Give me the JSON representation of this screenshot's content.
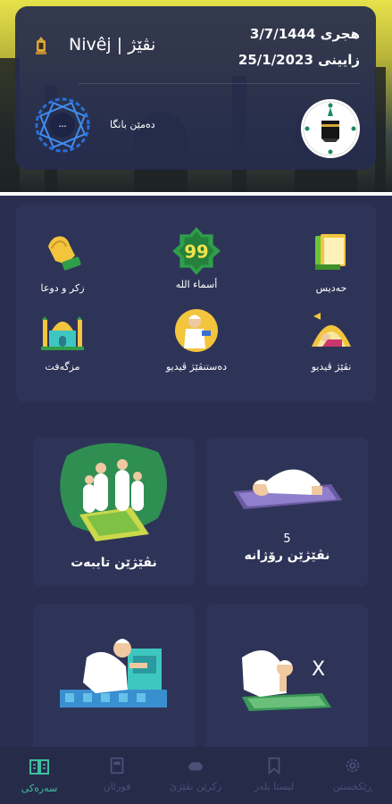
{
  "header": {
    "app_name": "Nivêj | نڤێژ",
    "hijri_date": "هجری 3/7/1444",
    "gregorian_date": "زایینی 25/1/2023",
    "adhan_label": "دەمێن بانگا"
  },
  "categories": [
    {
      "label": "حەدیس",
      "icon": "book-icon"
    },
    {
      "label": "أسماء الله",
      "icon": "99-names-icon",
      "badge": "99"
    },
    {
      "label": "زکر و دوعا",
      "icon": "praying-hands-icon"
    },
    {
      "label": "نڤێژ ڤیدیو",
      "icon": "prayer-video-icon"
    },
    {
      "label": "دەستنڤێژ ڤیدیو",
      "icon": "ablution-video-icon"
    },
    {
      "label": "مزگەفت",
      "icon": "mosque-icon"
    }
  ],
  "cards": [
    {
      "number": "5",
      "title": "نڤێژێن رۆژانە",
      "icon": "daily-prayers-icon"
    },
    {
      "title": "نڤێژێن تایبەت",
      "icon": "special-prayers-icon"
    },
    {
      "mark": "X",
      "icon": "prayer-mistakes-icon"
    },
    {
      "icon": "ablution-icon"
    }
  ],
  "nav": [
    {
      "label": "ڕێکخستن",
      "icon": "gear-icon",
      "active": false
    },
    {
      "label": "لیستا بلەز",
      "icon": "bookmark-icon",
      "active": false
    },
    {
      "label": "زکرێن نڤێژێ",
      "icon": "hands-icon",
      "active": false
    },
    {
      "label": "قورئان",
      "icon": "quran-icon",
      "active": false
    },
    {
      "label": "سەرەکی",
      "icon": "home-book-icon",
      "active": true
    }
  ],
  "colors": {
    "background": "#2a2f52",
    "panel": "#2e3458",
    "accent": "#3fbfa0",
    "inactive": "#4a5078"
  }
}
